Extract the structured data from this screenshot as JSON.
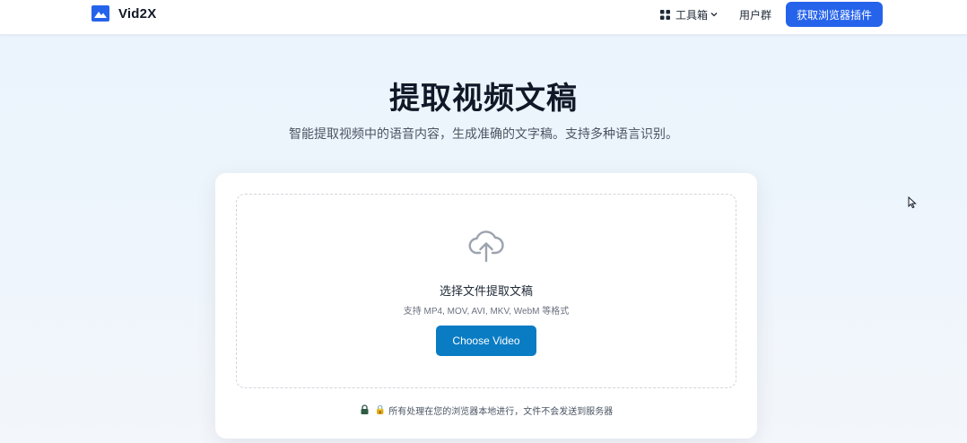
{
  "navbar": {
    "brand_name": "Vid2X",
    "brand_icon": "image-mountain-icon",
    "tools_label": "工具箱",
    "tools_icon": "grid-icon",
    "user_group_label": "用户群",
    "cta_label": "获取浏览器插件"
  },
  "hero": {
    "title": "提取视频文稿",
    "subtitle": "智能提取视频中的语音内容，生成准确的文字稿。支持多种语言识别。"
  },
  "upload": {
    "icon": "cloud-upload-icon",
    "title": "选择文件提取文稿",
    "hint": "支持 MP4, MOV, AVI, MKV, WebM 等格式",
    "button_label": "Choose Video"
  },
  "privacy": {
    "icon": "lock-icon",
    "glyph": "🔒",
    "text": "所有处理在您的浏览器本地进行，文件不会发送到服务器"
  },
  "colors": {
    "primary": "#2563eb",
    "choose_button": "#0a7cc4",
    "title_text": "#111827",
    "muted_text": "#4b5563"
  }
}
